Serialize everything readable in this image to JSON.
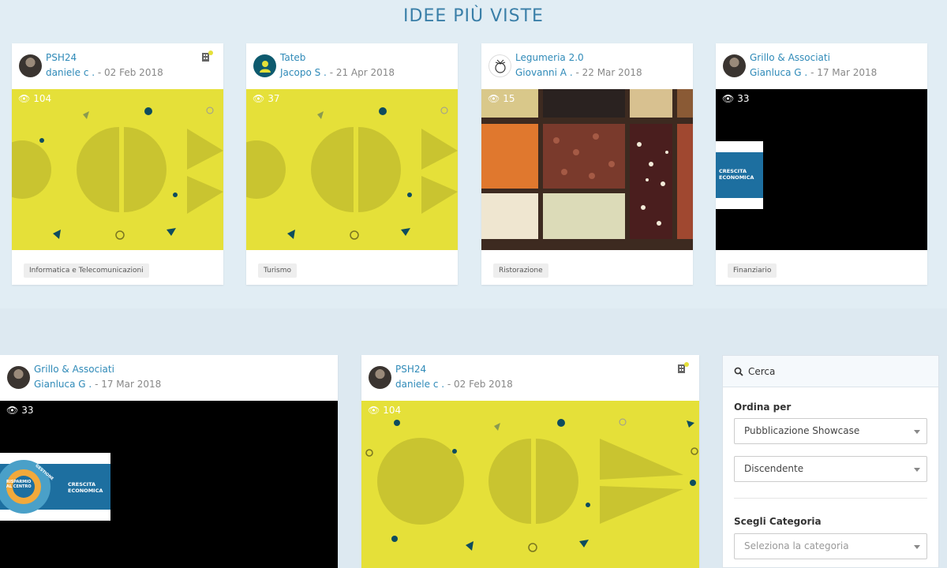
{
  "page": {
    "title": "IDEE PIÙ VISTE"
  },
  "cards": [
    {
      "name": "PSH24",
      "author": "daniele c .",
      "date": "- 02 Feb 2018",
      "views": "104",
      "tag": "Informatica e Telecomunicazioni",
      "badge": "1"
    },
    {
      "name": "Tateb",
      "author": "Jacopo S .",
      "date": "- 21 Apr 2018",
      "views": "37",
      "tag": "Turismo"
    },
    {
      "name": "Legumeria 2.0",
      "author": "Giovanni A .",
      "date": "- 22 Mar 2018",
      "views": "15",
      "tag": "Ristorazione"
    },
    {
      "name": "Grillo & Associati",
      "author": "Gianluca G .",
      "date": "- 17 Mar 2018",
      "views": "33",
      "tag": "Finanziario",
      "image_text": "CRESCITA ECONOMICA"
    },
    {
      "name": "Grillo & Associati",
      "author": "Gianluca G .",
      "date": "- 17 Mar 2018",
      "views": "33",
      "image_text": "CRESCITA ECONOMICA",
      "image_text2": "RISPARMIO AL CENTRO",
      "image_text3": "GESTIONE"
    },
    {
      "name": "PSH24",
      "author": "daniele c .",
      "date": "- 02 Feb 2018",
      "views": "104",
      "badge": "1"
    }
  ],
  "search_panel": {
    "title": "Cerca",
    "order_label": "Ordina per",
    "order_value": "Pubblicazione Showcase",
    "direction_value": "Discendente",
    "category_label": "Scegli Categoria",
    "category_placeholder": "Seleziona la categoria"
  },
  "colors": {
    "accent": "#2f8ab8",
    "title": "#3a7fa8",
    "yellow": "#e5e039",
    "background": "#e1edf4"
  }
}
